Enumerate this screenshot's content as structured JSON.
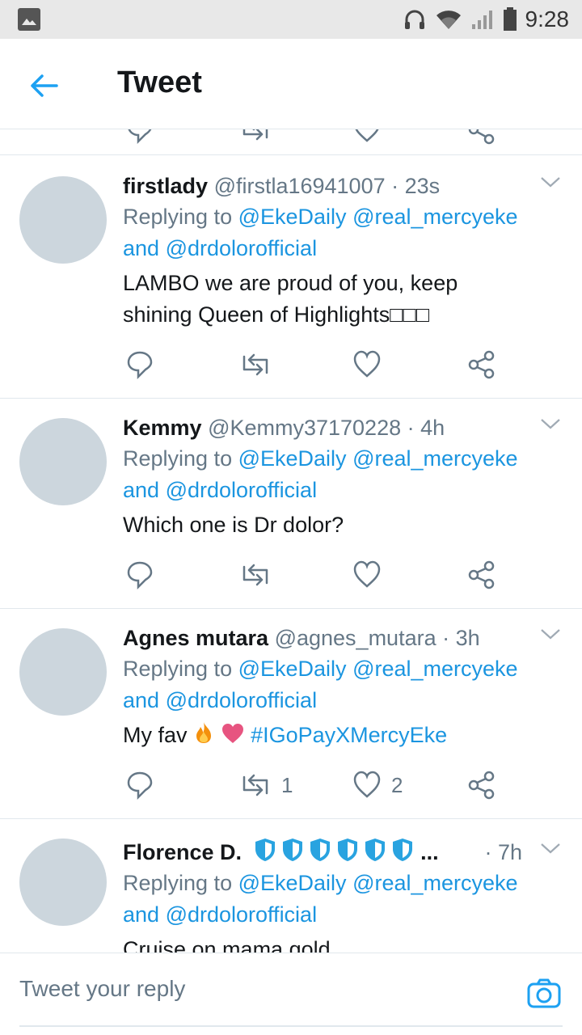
{
  "status_bar": {
    "time": "9:28"
  },
  "header": {
    "title": "Tweet"
  },
  "tweets": [
    {
      "name": "firstlady",
      "handle": "@firstla16941007",
      "time": "23s",
      "replying_prefix": "Replying to",
      "mentions": [
        "@EkeDaily",
        "@real_mercyeke"
      ],
      "and_text": "and",
      "last_mention": "@drdolorofficial",
      "text_line1": "LAMBO we are proud of you, keep",
      "text_line2": "shining Queen of Highlights□□□",
      "retweets": "",
      "likes": ""
    },
    {
      "name": "Kemmy",
      "handle": "@Kemmy37170228",
      "time": "4h",
      "replying_prefix": "Replying to",
      "mentions": [
        "@EkeDaily",
        "@real_mercyeke"
      ],
      "and_text": "and",
      "last_mention": "@drdolorofficial",
      "text_line1": "Which one is Dr dolor?",
      "retweets": "",
      "likes": ""
    },
    {
      "name": "Agnes mutara",
      "handle": "@agnes_mutara",
      "time": "3h",
      "replying_prefix": "Replying to",
      "mentions": [
        "@EkeDaily",
        "@real_mercyeke"
      ],
      "and_text": "and",
      "last_mention": "@drdolorofficial",
      "text_prefix": "My fav",
      "hashtag": "#IGoPayXMercyEke",
      "retweets": "1",
      "likes": "2"
    },
    {
      "name": "Florence D.",
      "ellipsis": "...",
      "time": "7h",
      "replying_prefix": "Replying to",
      "mentions": [
        "@EkeDaily",
        "@real_mercyeke"
      ],
      "and_text": "and",
      "last_mention": "@drdolorofficial",
      "text_line1": "Cruise on mama gold"
    }
  ],
  "reply_bar": {
    "placeholder": "Tweet your reply"
  },
  "colors": {
    "accent": "#1b95e0",
    "secondary_text": "#657786",
    "avatar": "#ccd6dd",
    "divider": "#e1e8ed"
  }
}
